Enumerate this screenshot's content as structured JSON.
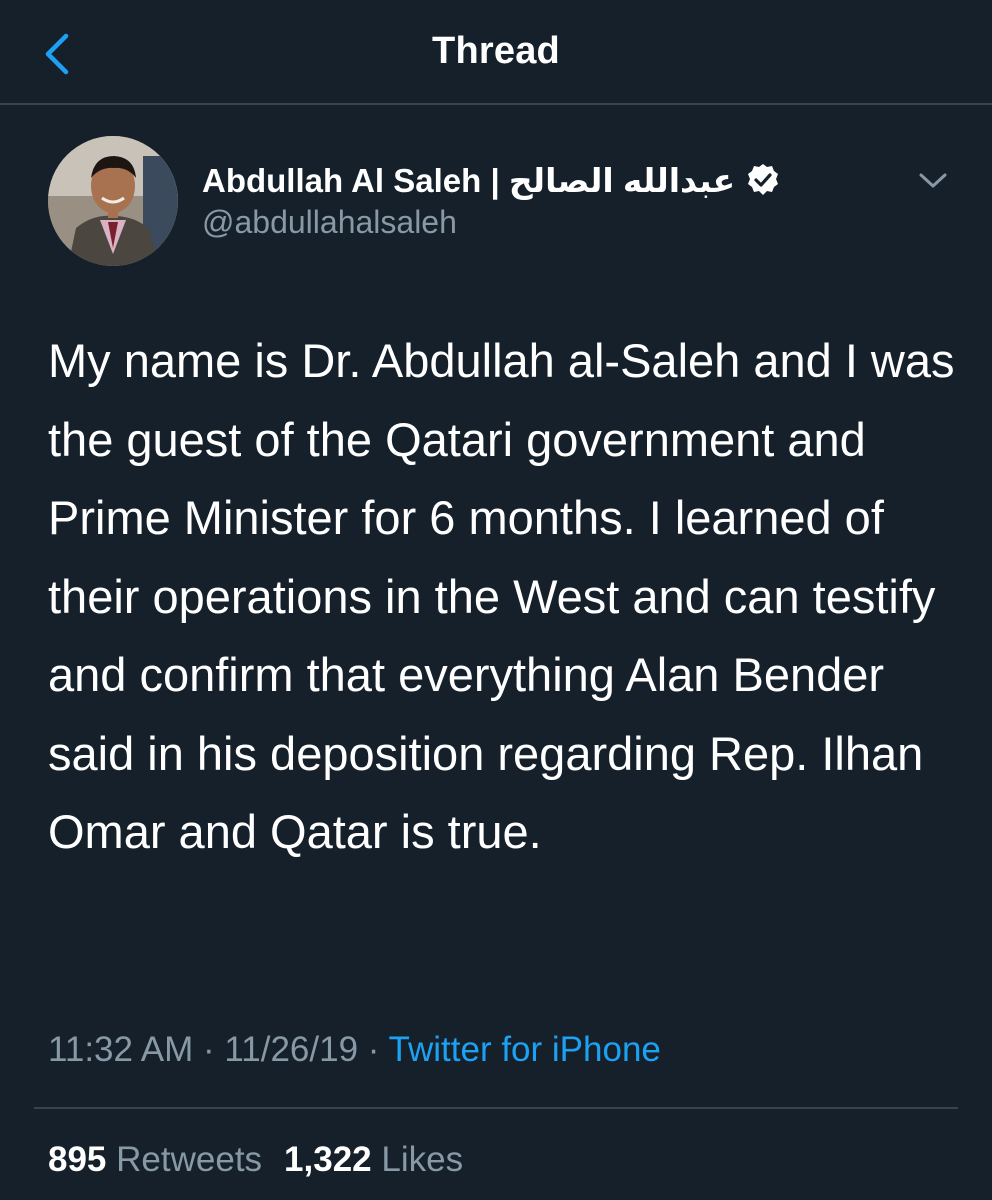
{
  "header": {
    "title": "Thread",
    "back_icon": "chevron-left-icon",
    "accent_color": "#1da1f2"
  },
  "tweet": {
    "author": {
      "name": "Abdullah Al Saleh | عبدالله الصالح",
      "handle": "@abdullahalsaleh",
      "verified": true,
      "verified_icon": "verified-badge-icon"
    },
    "more_icon": "chevron-down-icon",
    "text": "My name is Dr. Abdullah al-Saleh and I was the guest of the Qatari government and Prime Minister for 6 months. I learned of their operations in the West and can testify and confirm that everything Alan Bender said in his deposition regarding Rep. Ilhan Omar and Qatar is true.",
    "time": "11:32 AM",
    "date": "11/26/19",
    "separator": " · ",
    "source": "Twitter for iPhone"
  },
  "stats": {
    "retweets_count": "895",
    "retweets_label": "Retweets",
    "likes_count": "1,322",
    "likes_label": "Likes"
  },
  "colors": {
    "background": "#15202b",
    "text_secondary": "#8899a6",
    "divider": "#38444d",
    "link": "#1da1f2"
  }
}
